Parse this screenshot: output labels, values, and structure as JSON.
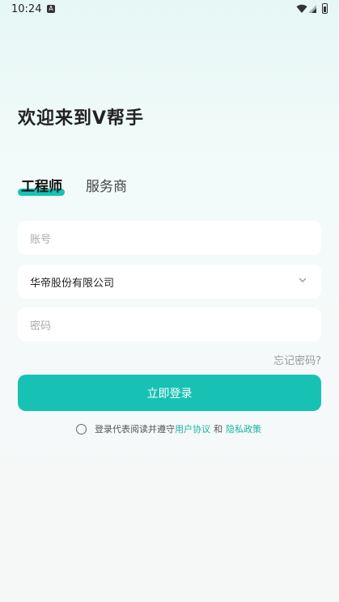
{
  "status_bar": {
    "time": "10:24",
    "notif_letter": "A"
  },
  "welcome": "欢迎来到V帮手",
  "tabs": [
    {
      "label": "工程师",
      "active": true
    },
    {
      "label": "服务商",
      "active": false
    }
  ],
  "form": {
    "account_placeholder": "账号",
    "company_value": "华帝股份有限公司",
    "password_placeholder": "密码"
  },
  "forgot_label": "忘记密码?",
  "login_label": "立即登录",
  "agreement": {
    "prefix": "登录代表阅读并遵守",
    "user_agreement": "用户协议",
    "and": "和",
    "privacy_policy": "隐私政策"
  },
  "colors": {
    "accent": "#17c2b4"
  }
}
